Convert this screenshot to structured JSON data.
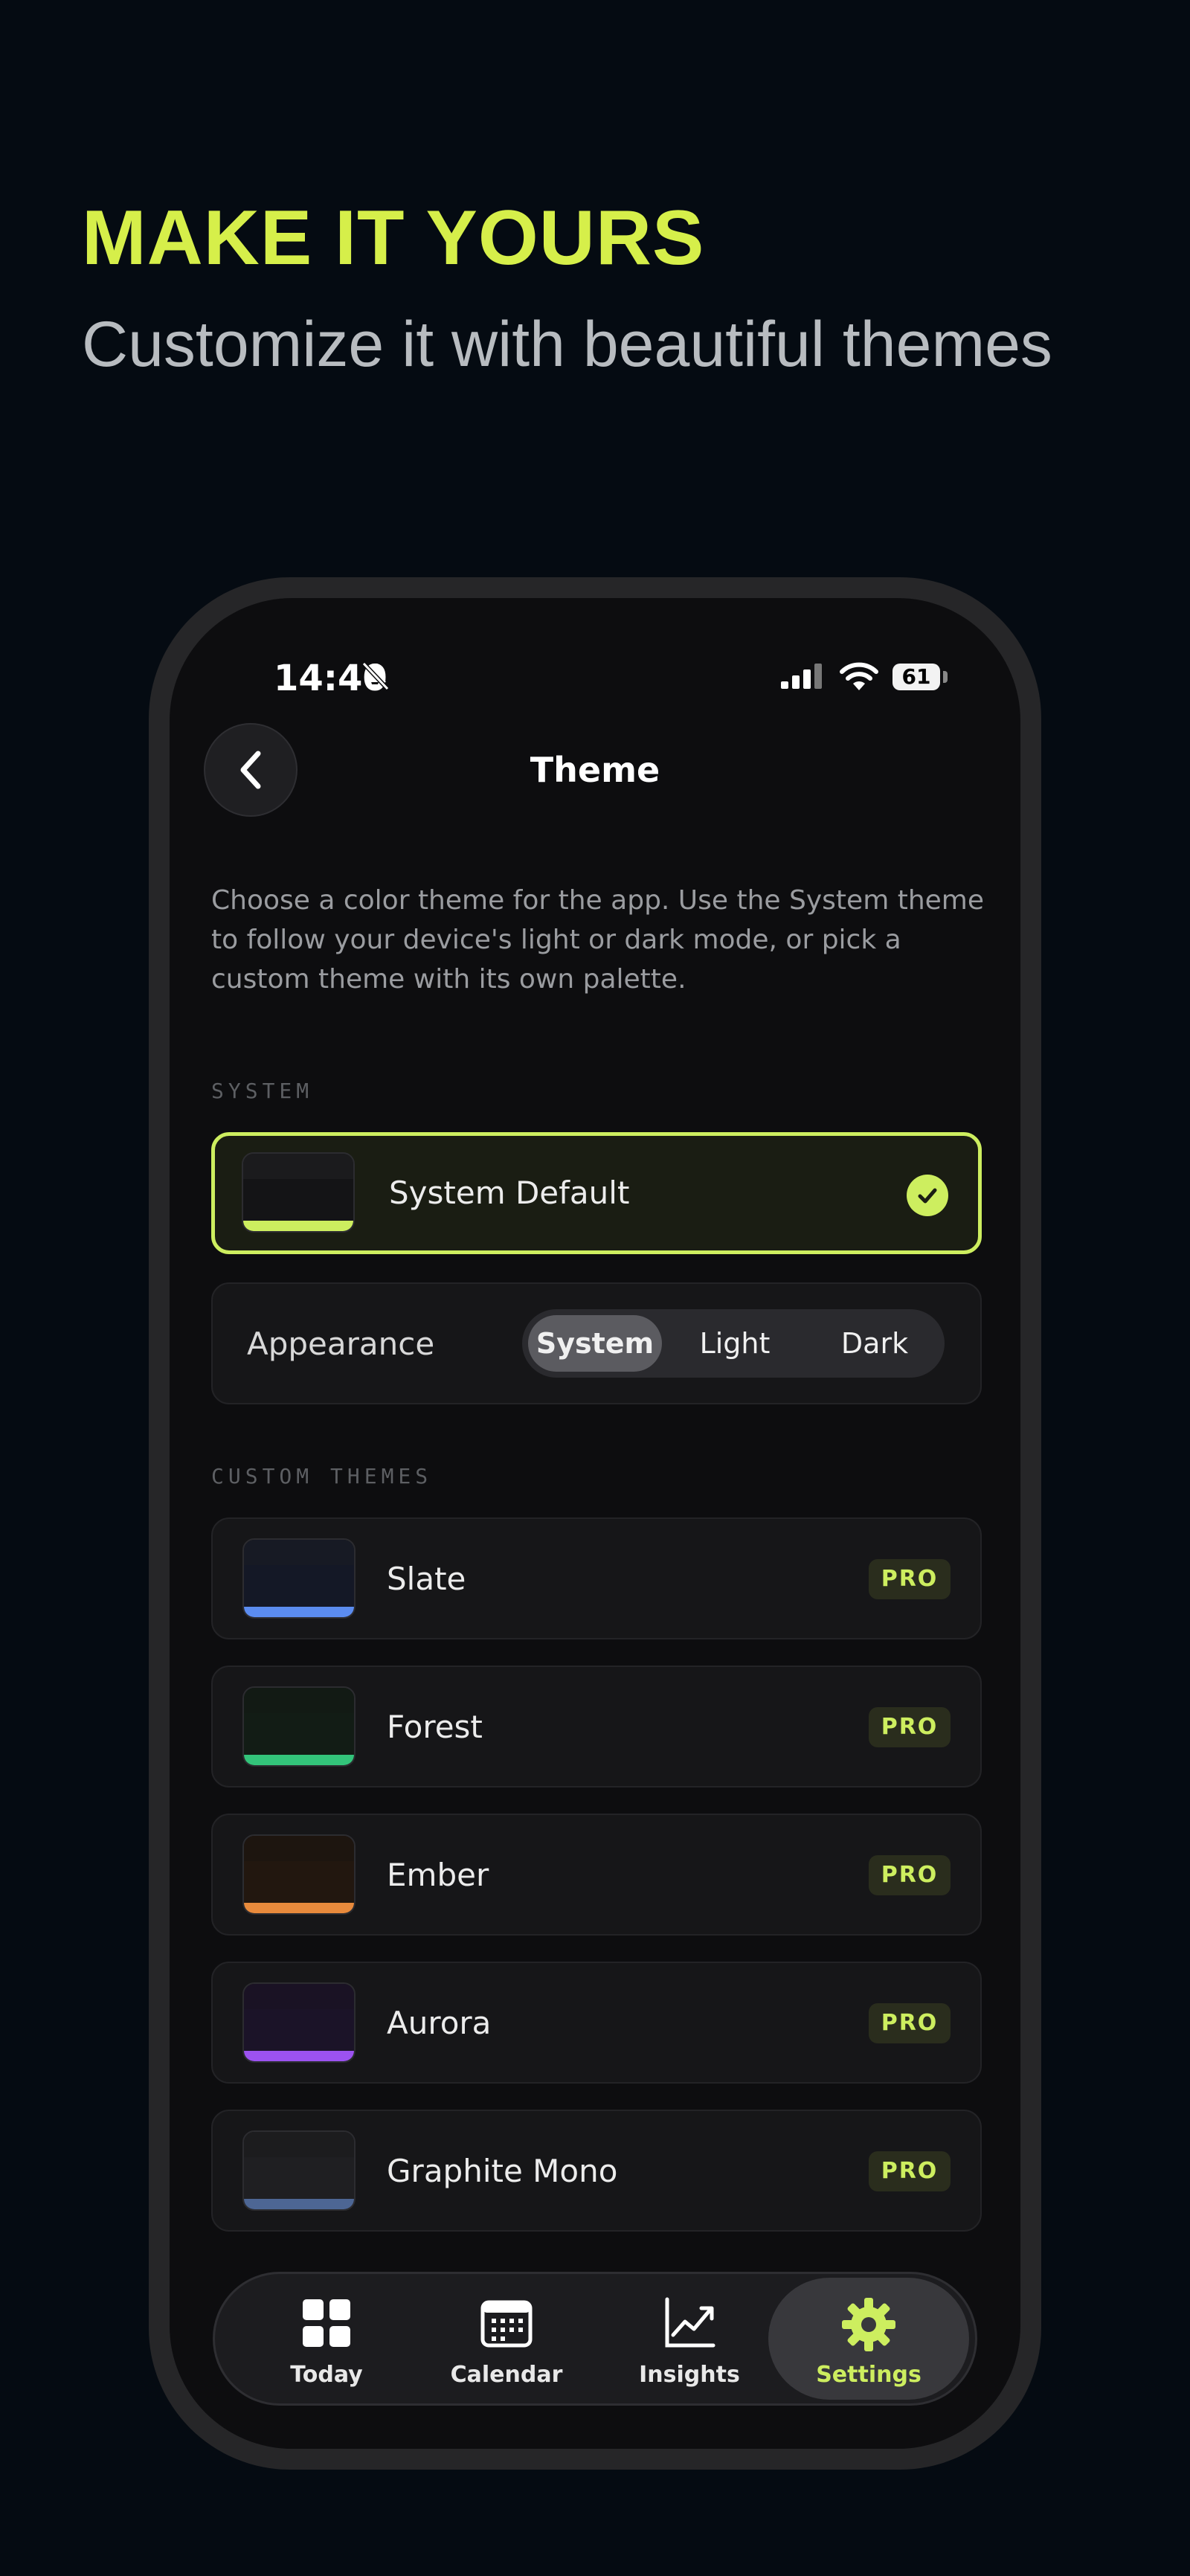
{
  "promo": {
    "headline": "MAKE IT YOURS",
    "subheadline": "Customize it with beautiful themes",
    "accent_color": "#d6ef4a"
  },
  "status_bar": {
    "time": "14:40",
    "battery": "61"
  },
  "header": {
    "title": "Theme",
    "back_icon": "chevron-left-icon"
  },
  "description": "Choose a color theme for the app. Use the System theme to follow your device's light or dark mode, or pick a custom theme with its own palette.",
  "system_section": {
    "label": "SYSTEM",
    "default_theme": {
      "name": "System Default",
      "selected": true,
      "colors": [
        "#1b1b1d",
        "#141416",
        "#cdee5f"
      ]
    },
    "appearance": {
      "label": "Appearance",
      "options": [
        "System",
        "Light",
        "Dark"
      ],
      "selected": "System"
    }
  },
  "custom_section": {
    "label": "CUSTOM THEMES",
    "badge": "PRO",
    "themes": [
      {
        "name": "Slate",
        "colors": [
          "#171a24",
          "#141826",
          "#5b8cf0"
        ]
      },
      {
        "name": "Forest",
        "colors": [
          "#121a14",
          "#121c15",
          "#33c47a"
        ]
      },
      {
        "name": "Ember",
        "colors": [
          "#1d150f",
          "#22170f",
          "#e88a3c"
        ]
      },
      {
        "name": "Aurora",
        "colors": [
          "#1a1224",
          "#1b1328",
          "#9c52f0"
        ]
      },
      {
        "name": "Graphite Mono",
        "colors": [
          "#1c1c1e",
          "#1f1f22",
          "#4d6694"
        ]
      }
    ]
  },
  "tab_bar": {
    "tabs": [
      {
        "label": "Today",
        "icon": "grid-icon"
      },
      {
        "label": "Calendar",
        "icon": "calendar-icon"
      },
      {
        "label": "Insights",
        "icon": "chart-icon"
      },
      {
        "label": "Settings",
        "icon": "gear-icon"
      }
    ],
    "active": "Settings"
  }
}
